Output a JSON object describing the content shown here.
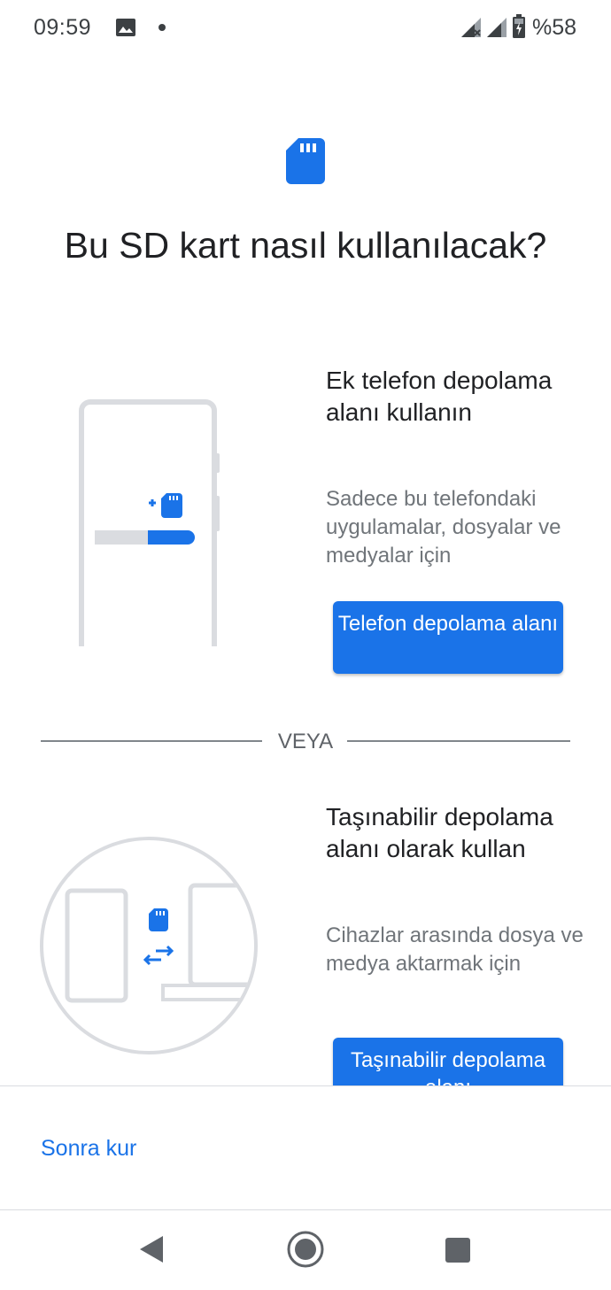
{
  "status_bar": {
    "time": "09:59",
    "battery_percent": "%58",
    "icons": [
      "image-icon",
      "notification-dot",
      "signal-no-data-icon",
      "signal-icon",
      "battery-charging-icon"
    ]
  },
  "header": {
    "icon": "sd-card-icon",
    "title": "Bu SD kart nasıl kullanılacak?"
  },
  "options": [
    {
      "title": "Ek telefon depolama alanı kullanın",
      "description": "Sadece bu telefondaki uygulamalar, dosyalar ve medyalar için",
      "button_label": "Telefon depolama alanı",
      "illustration": "phone-storage-illustration"
    },
    {
      "title": "Taşınabilir depolama alanı olarak kullan",
      "description": "Cihazlar arasında dosya ve medya aktarmak için",
      "button_label": "Taşınabilir depolama alanı",
      "illustration": "portable-storage-illustration"
    }
  ],
  "divider_label": "VEYA",
  "footer": {
    "later_label": "Sonra kur"
  },
  "nav": {
    "icons": [
      "back-icon",
      "home-icon",
      "recents-icon"
    ]
  },
  "colors": {
    "accent": "#1a73e8",
    "text_primary": "#202124",
    "text_secondary": "#70757a",
    "illustration_gray": "#dadce0"
  }
}
